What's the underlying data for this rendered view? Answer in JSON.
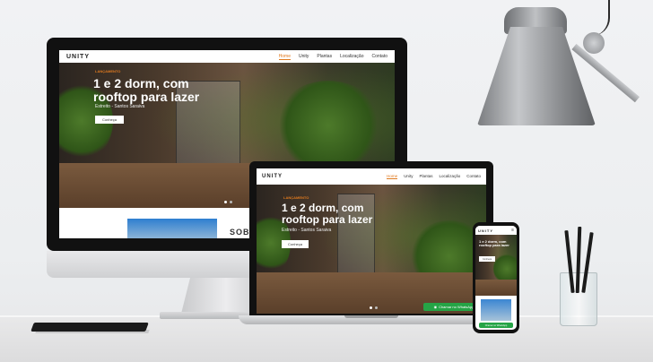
{
  "site": {
    "logo": "UNITY",
    "nav": [
      "Home",
      "Unity",
      "Plantas",
      "Localização",
      "Contato"
    ],
    "hero_tag": "LANÇAMENTO",
    "headline_line1": "1 e 2 dorm, com",
    "headline_line2": "rooftop para lazer",
    "location": "Estreito - Santos Saraiva",
    "cta": "Conheça",
    "section_peek": "SOBRE",
    "whatsapp": "Chamar no WhatsApp"
  },
  "colors": {
    "accent": "#e07a1f",
    "whatsapp": "#25a446",
    "device_frame": "#111111"
  },
  "icons": [
    "desk-lamp",
    "pencil-cup",
    "notebook",
    "whatsapp-icon"
  ]
}
